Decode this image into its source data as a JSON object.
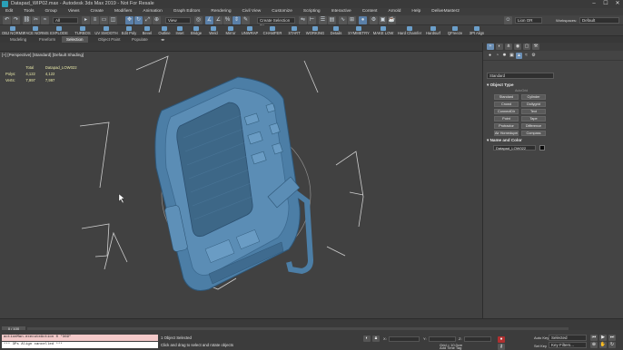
{
  "window": {
    "title": "Datapad_WIP02.max - Autodesk 3ds Max 2019 - Not For Resale",
    "minimize": "–",
    "maximize": "☐",
    "close": "✕"
  },
  "menu": {
    "items": [
      "Edit",
      "Tools",
      "Group",
      "Views",
      "Create",
      "Modifiers",
      "Animation",
      "Graph Editors",
      "Rendering",
      "Civil View",
      "Customize",
      "Scripting",
      "Interactive",
      "Content",
      "Arnold",
      "Help",
      "DeliveMaster2"
    ]
  },
  "toolbar": {
    "filter_value": "All",
    "refcoord_value": "View",
    "named_selection_placeholder": "Create Selection Se",
    "user_name": "Lion OR",
    "workspace_label": "Workspaces:",
    "workspace_value": "Default"
  },
  "ribbon": {
    "items": [
      "OBJ NORMS",
      "FACE NORMS",
      "EXPLODE",
      "TURBOS",
      "UV SMOOTH",
      "Edit Poly",
      "Bevel",
      "Outline",
      "Inset",
      "Bridge",
      "Weld",
      "Mirror",
      "UNWRAP",
      "CHAMFER",
      "START",
      "WORKING",
      "Details",
      "SYMMETRY",
      "MAKE LOW",
      "Hard Chamfer",
      "Hardsurf",
      "QFreeze",
      "3Pt Align"
    ]
  },
  "subribbon": {
    "tabs": [
      "Modeling",
      "Freeform",
      "Selection",
      "Object Paint",
      "Populate"
    ],
    "active_index": 2
  },
  "viewport": {
    "label": "[+] [Perspective] [Standard] [Default Shading]",
    "stats": {
      "header_total": "Total",
      "header_object": "Datapad_LOW022",
      "polys_label": "Polys:",
      "polys_total": "4,122",
      "polys_object": "4,122",
      "verts_label": "Verts:",
      "verts_total": "7,997",
      "verts_object": "7,997"
    },
    "model_color": "#4a7fa8",
    "background": "#414141"
  },
  "command_panel": {
    "category_value": "Standard",
    "object_type_header": "Object Type",
    "autogrid_label": "AutoGrid",
    "buttons": [
      "Standard",
      "Cylinder",
      "Crowd",
      "Dollygrid",
      "ConnectDir",
      "Text",
      "Point",
      "Tape",
      "Protractor",
      "Difference",
      "Air Horneduper",
      "Compass"
    ],
    "name_color_header": "Name and Color",
    "object_name": "Datapad_LOW022",
    "object_color": "#0a0a0a"
  },
  "timeline": {
    "frame_counter": "0 / 100"
  },
  "status": {
    "maxscript_line1": "actionMan.executeAction 0 \"369\"",
    "maxscript_line2": "*** 3Ps Align cancelled ***",
    "selection_info": "1 Object Selected",
    "prompt": "Click and drag to select and rotate objects",
    "x_label": "X:",
    "y_label": "Y:",
    "z_label": "Z:",
    "grid_label": "Grid = 10.0cm",
    "add_time_tag": "Add Time Tag",
    "auto_key": "Auto Key",
    "set_key": "Set Key",
    "selected_value": "Selected",
    "key_filters": "Key Filters..."
  }
}
